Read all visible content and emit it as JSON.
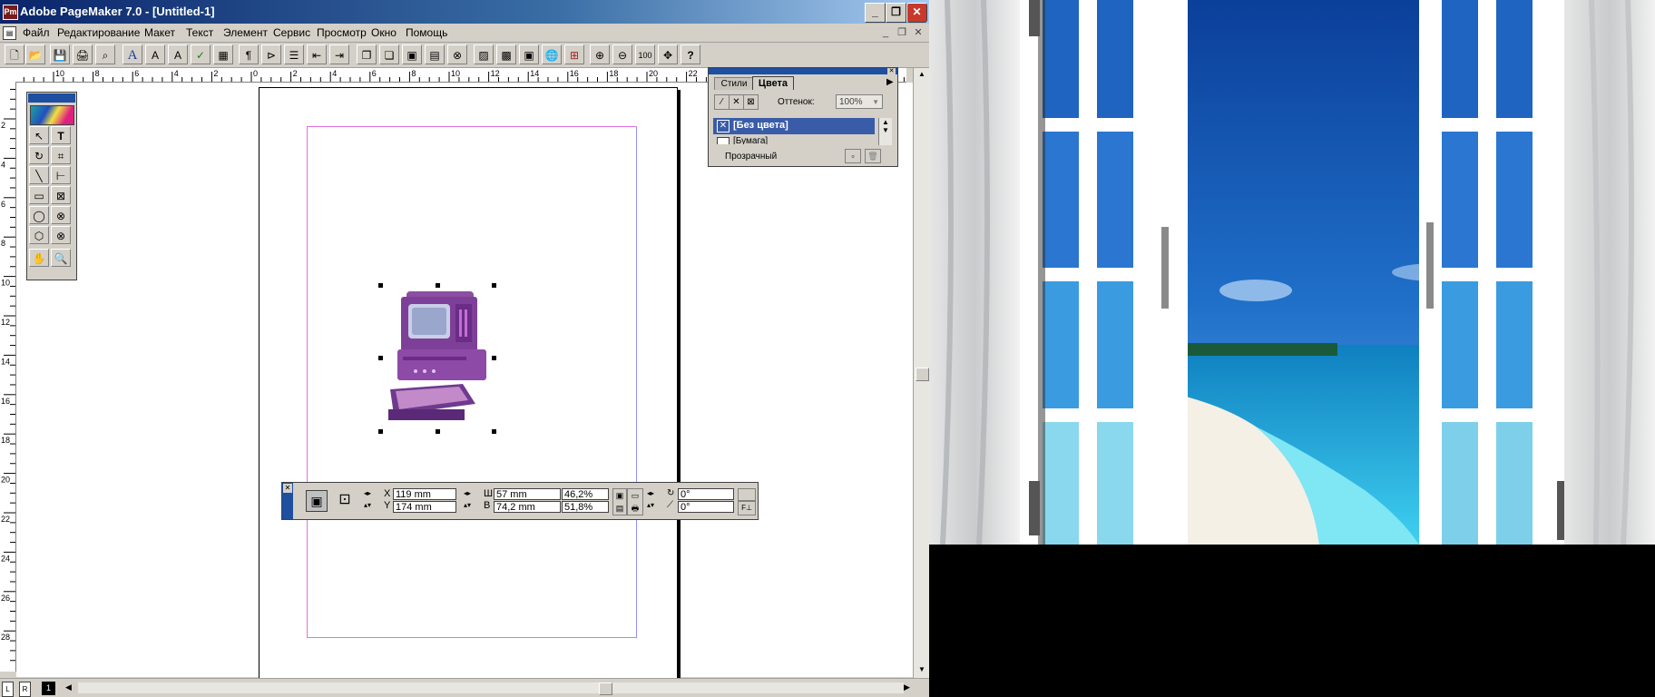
{
  "window": {
    "title": "Adobe PageMaker 7.0 - [Untitled-1]",
    "close_glyph": "✕",
    "min_glyph": "_",
    "max_glyph": "❐"
  },
  "menu": [
    "Файл",
    "Редактирование",
    "Макет",
    "Текст",
    "Элемент",
    "Сервис",
    "Просмотр",
    "Окно",
    "Помощь"
  ],
  "toolbar": {
    "buttons": [
      "🗋",
      "📂",
      "💾",
      "🖨",
      "⌕",
      "A",
      "A",
      "A",
      "✓",
      "▦",
      "¶",
      "⊳",
      "☰",
      "⇤",
      "⇥",
      "❐",
      "❏",
      "▣",
      "▤",
      "⊗",
      "▨",
      "▩",
      "▣",
      "🌐",
      "⊞",
      "⊕",
      "⊖",
      "100",
      "✥",
      "?"
    ]
  },
  "rulers": {
    "h_labels": [
      "10",
      "8",
      "6",
      "4",
      "2",
      "0",
      "2",
      "4",
      "6",
      "8",
      "10",
      "12",
      "14",
      "16",
      "18",
      "20",
      "22"
    ],
    "v_labels": [
      "2",
      "4",
      "6",
      "8",
      "10",
      "12",
      "14",
      "16",
      "18",
      "20",
      "22",
      "24",
      "26",
      "28"
    ]
  },
  "toolbox": {
    "tools": [
      "↖",
      "T",
      "↻",
      "⌗",
      "╲",
      "⊢",
      "▭",
      "⊠",
      "◯",
      "⊗",
      "⬡",
      "⊗",
      "✋",
      "🔍"
    ],
    "tool_names": [
      "pointer-tool-icon",
      "text-tool-icon",
      "rotate-tool-icon",
      "crop-tool-icon",
      "line-tool-icon",
      "constrained-line-tool-icon",
      "rectangle-tool-icon",
      "rectangle-frame-tool-icon",
      "ellipse-tool-icon",
      "ellipse-frame-tool-icon",
      "polygon-tool-icon",
      "polygon-frame-tool-icon",
      "hand-tool-icon",
      "zoom-tool-icon"
    ]
  },
  "colors_palette": {
    "tabs": [
      "Стили",
      "Цвета"
    ],
    "tint_label": "Оттенок:",
    "tint_value": "100%",
    "items": [
      "[Без цвета]",
      "[Бумага]"
    ],
    "footer_label": "Прозрачный"
  },
  "control_palette": {
    "x_label": "X",
    "x_value": "119 mm",
    "y_label": "Y",
    "y_value": "174 mm",
    "w_label": "Ш",
    "w_value": "57 mm",
    "h_label": "В",
    "h_value": "74,2 mm",
    "scale_w": "46,2%",
    "scale_h": "51,8%",
    "rotation": "0°",
    "skew": "0°"
  },
  "page_tabs": [
    "L",
    "R",
    "1"
  ],
  "colors": {
    "title_start": "#0a246a",
    "title_end": "#a6caf0",
    "selected_item": "#3a5ca8",
    "margin_guide": "#e070e0",
    "sky": "#1a5fb8",
    "sea": "#1aa6d8"
  }
}
